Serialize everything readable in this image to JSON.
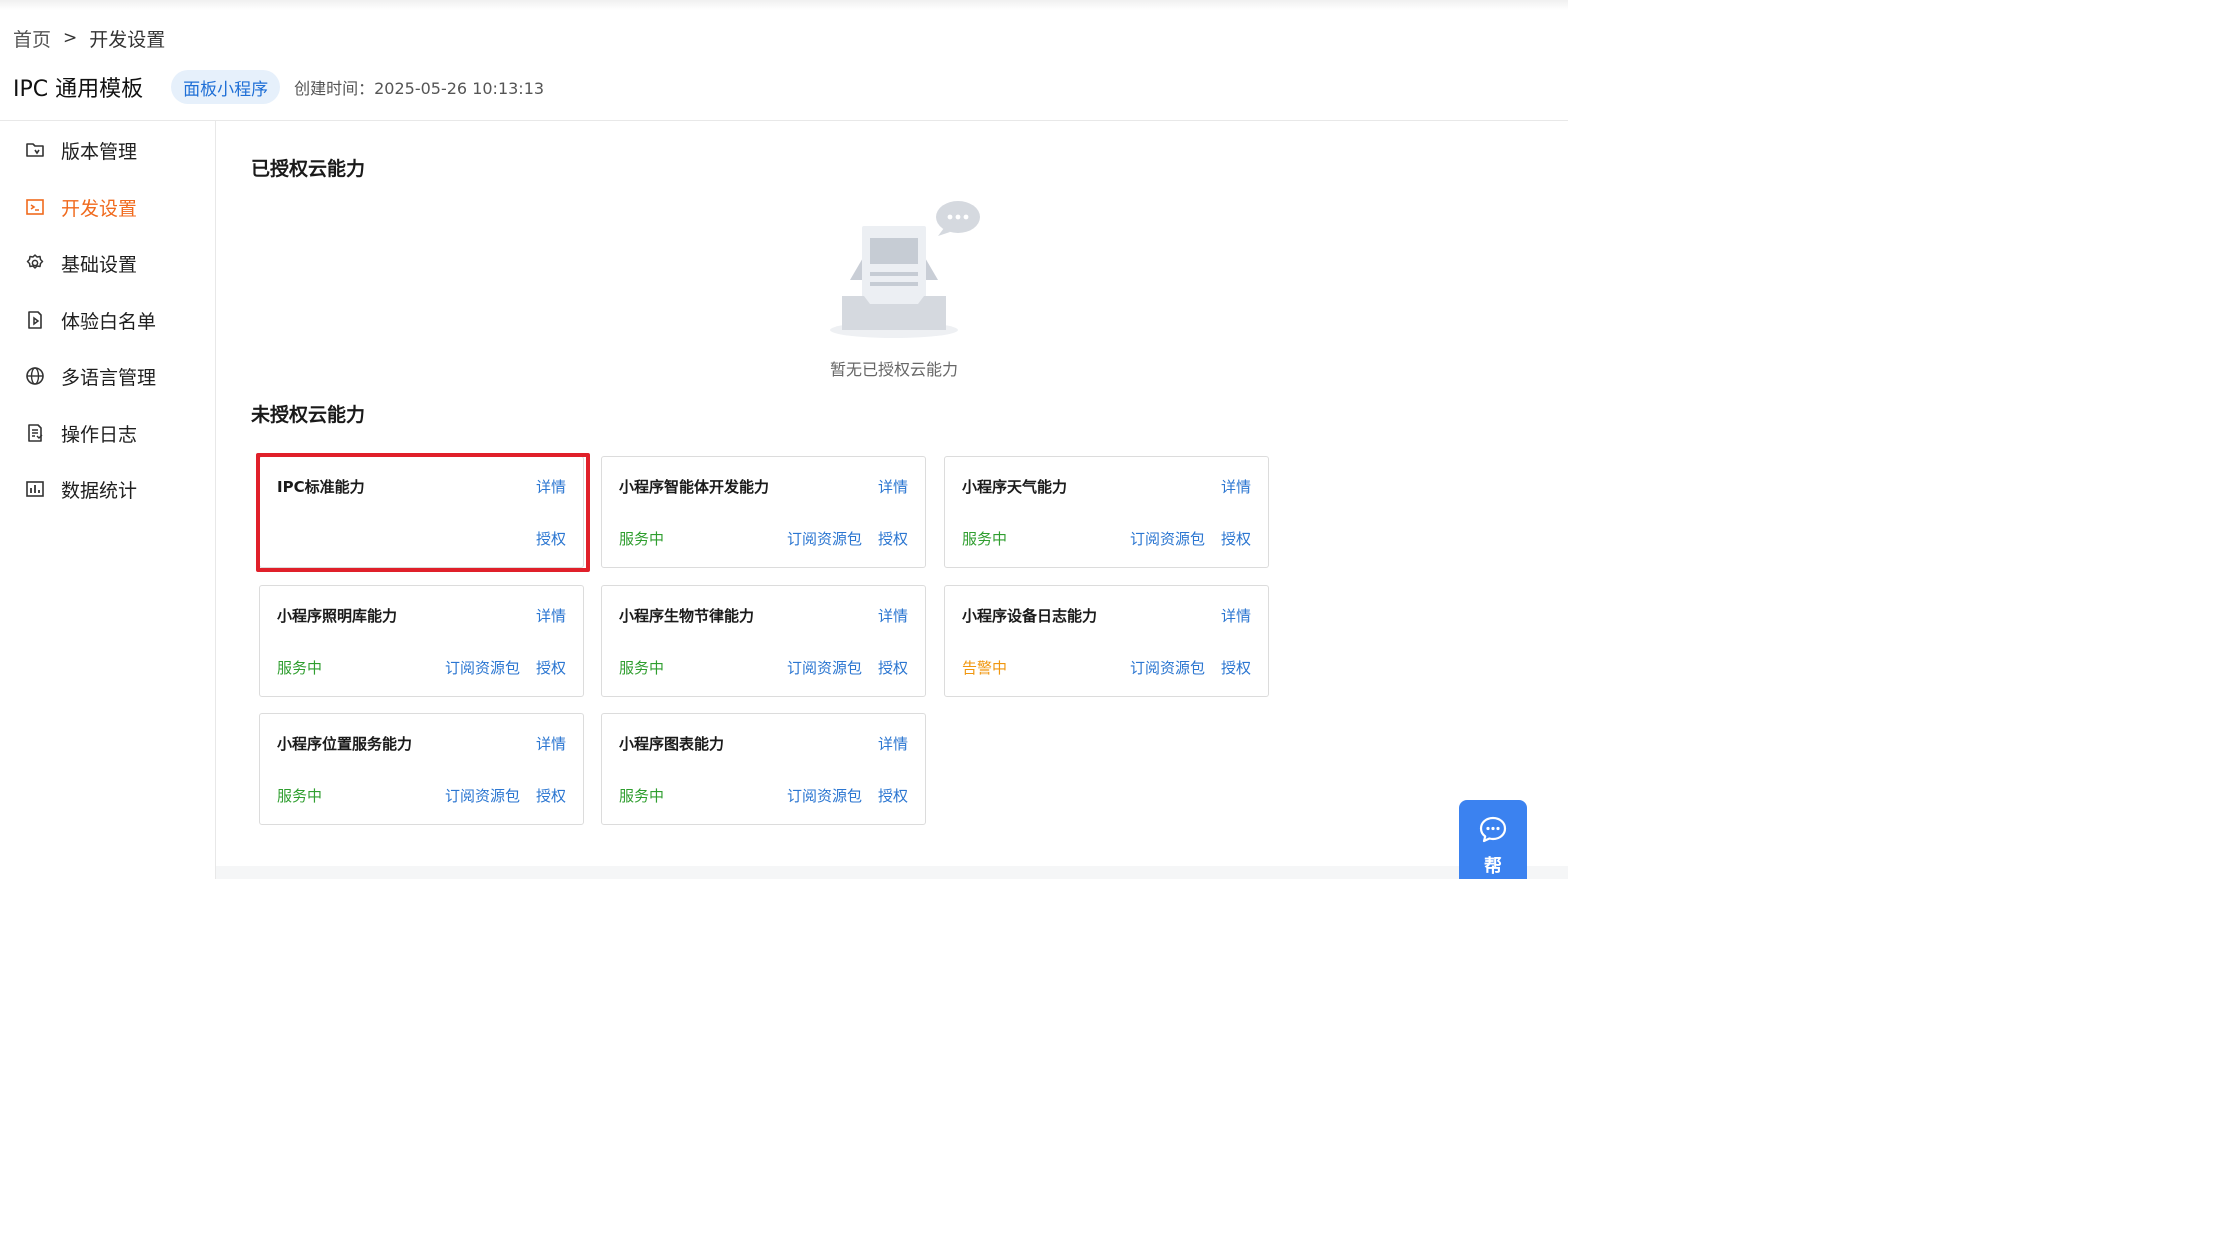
{
  "breadcrumb": {
    "home": "首页",
    "separator": ">",
    "current": "开发设置"
  },
  "header": {
    "title": "IPC 通用模板",
    "tag": "面板小程序",
    "created": "创建时间：2025-05-26 10:13:13"
  },
  "sidebar": {
    "items": [
      {
        "label": "版本管理",
        "icon": "folder-version-icon",
        "active": false
      },
      {
        "label": "开发设置",
        "icon": "terminal-icon",
        "active": true
      },
      {
        "label": "基础设置",
        "icon": "gear-icon",
        "active": false
      },
      {
        "label": "体验白名单",
        "icon": "document-play-icon",
        "active": false
      },
      {
        "label": "多语言管理",
        "icon": "globe-icon",
        "active": false
      },
      {
        "label": "操作日志",
        "icon": "log-file-icon",
        "active": false
      },
      {
        "label": "数据统计",
        "icon": "bar-chart-icon",
        "active": false
      }
    ]
  },
  "authorized": {
    "title": "已授权云能力",
    "empty_text": "暂无已授权云能力"
  },
  "unauthorized": {
    "title": "未授权云能力",
    "cards": [
      {
        "name": "IPC标准能力",
        "detail": "详情",
        "status": "",
        "subscribe": "",
        "authorize": "授权"
      },
      {
        "name": "小程序智能体开发能力",
        "detail": "详情",
        "status": "服务中",
        "subscribe": "订阅资源包",
        "authorize": "授权"
      },
      {
        "name": "小程序天气能力",
        "detail": "详情",
        "status": "服务中",
        "subscribe": "订阅资源包",
        "authorize": "授权"
      },
      {
        "name": "小程序照明库能力",
        "detail": "详情",
        "status": "服务中",
        "subscribe": "订阅资源包",
        "authorize": "授权"
      },
      {
        "name": "小程序生物节律能力",
        "detail": "详情",
        "status": "服务中",
        "subscribe": "订阅资源包",
        "authorize": "授权"
      },
      {
        "name": "小程序设备日志能力",
        "detail": "详情",
        "status": "告警中",
        "subscribe": "订阅资源包",
        "authorize": "授权"
      },
      {
        "name": "小程序位置服务能力",
        "detail": "详情",
        "status": "服务中",
        "subscribe": "订阅资源包",
        "authorize": "授权"
      },
      {
        "name": "小程序图表能力",
        "detail": "详情",
        "status": "服务中",
        "subscribe": "订阅资源包",
        "authorize": "授权"
      }
    ]
  },
  "help": {
    "label": "帮",
    "icon": "chat-bubble-icon"
  },
  "colors": {
    "accent": "#f06a1d",
    "link": "#2b76d1",
    "ok": "#2f9e2f",
    "warn": "#f0960e",
    "highlight": "#e0202a",
    "help": "#3b82f0"
  }
}
